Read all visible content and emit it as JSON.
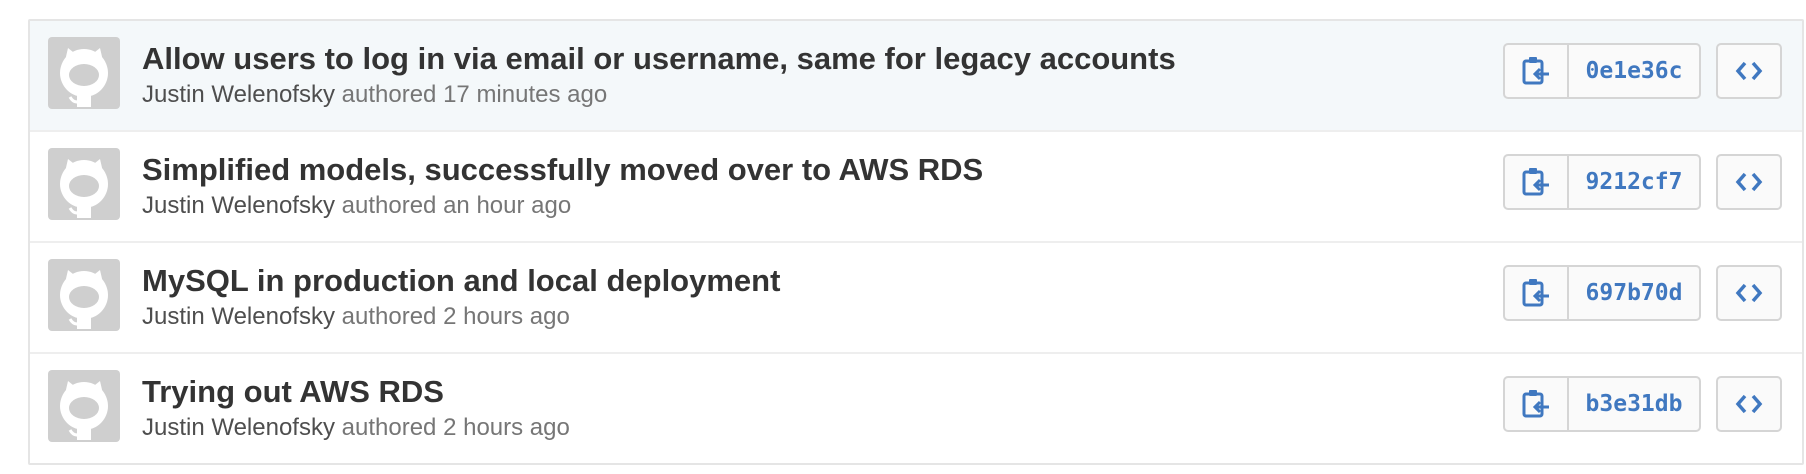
{
  "colors": {
    "link_blue": "#4078c0",
    "title_text": "#333333",
    "meta_text": "#767676",
    "highlight_row_bg": "#f4f8fa",
    "avatar_bg": "#cfcfcf"
  },
  "icons": {
    "avatar": "octocat-avatar-icon",
    "copy": "clipboard-copy-icon",
    "browse": "code-brackets-icon"
  },
  "commits": [
    {
      "title": "Allow users to log in via email or username, same for legacy accounts",
      "author": "Justin Welenofsky",
      "action": "authored",
      "time": "17 minutes ago",
      "sha": "0e1e36c"
    },
    {
      "title": "Simplified models, successfully moved over to AWS RDS",
      "author": "Justin Welenofsky",
      "action": "authored",
      "time": "an hour ago",
      "sha": "9212cf7"
    },
    {
      "title": "MySQL in production and local deployment",
      "author": "Justin Welenofsky",
      "action": "authored",
      "time": "2 hours ago",
      "sha": "697b70d"
    },
    {
      "title": "Trying out AWS RDS",
      "author": "Justin Welenofsky",
      "action": "authored",
      "time": "2 hours ago",
      "sha": "b3e31db"
    }
  ]
}
